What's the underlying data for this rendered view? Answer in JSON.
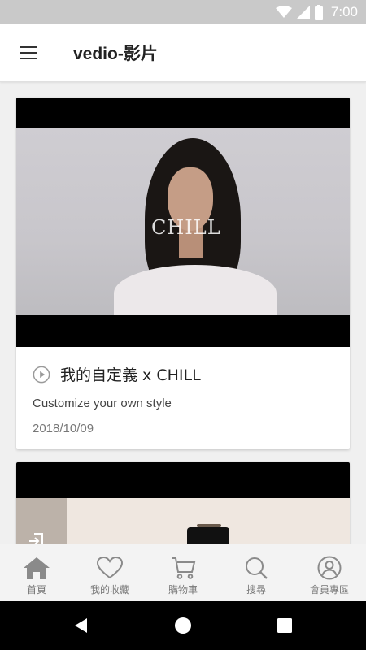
{
  "status_bar": {
    "time": "7:00"
  },
  "app_bar": {
    "title": "vedio-影片"
  },
  "videos": [
    {
      "overlay_text": "CHILL",
      "title": "我的自定義 x CHILL",
      "subtitle": "Customize your own style",
      "date": "2018/10/09"
    }
  ],
  "bottom_nav": [
    {
      "label": "首頁",
      "icon": "home-icon",
      "active": true
    },
    {
      "label": "我的收藏",
      "icon": "heart-icon"
    },
    {
      "label": "購物車",
      "icon": "cart-icon"
    },
    {
      "label": "搜尋",
      "icon": "search-icon"
    },
    {
      "label": "會員專區",
      "icon": "account-icon"
    }
  ],
  "colors": {
    "icon_gray": "#8a8a8a",
    "status_bar": "#c9c9c9"
  }
}
